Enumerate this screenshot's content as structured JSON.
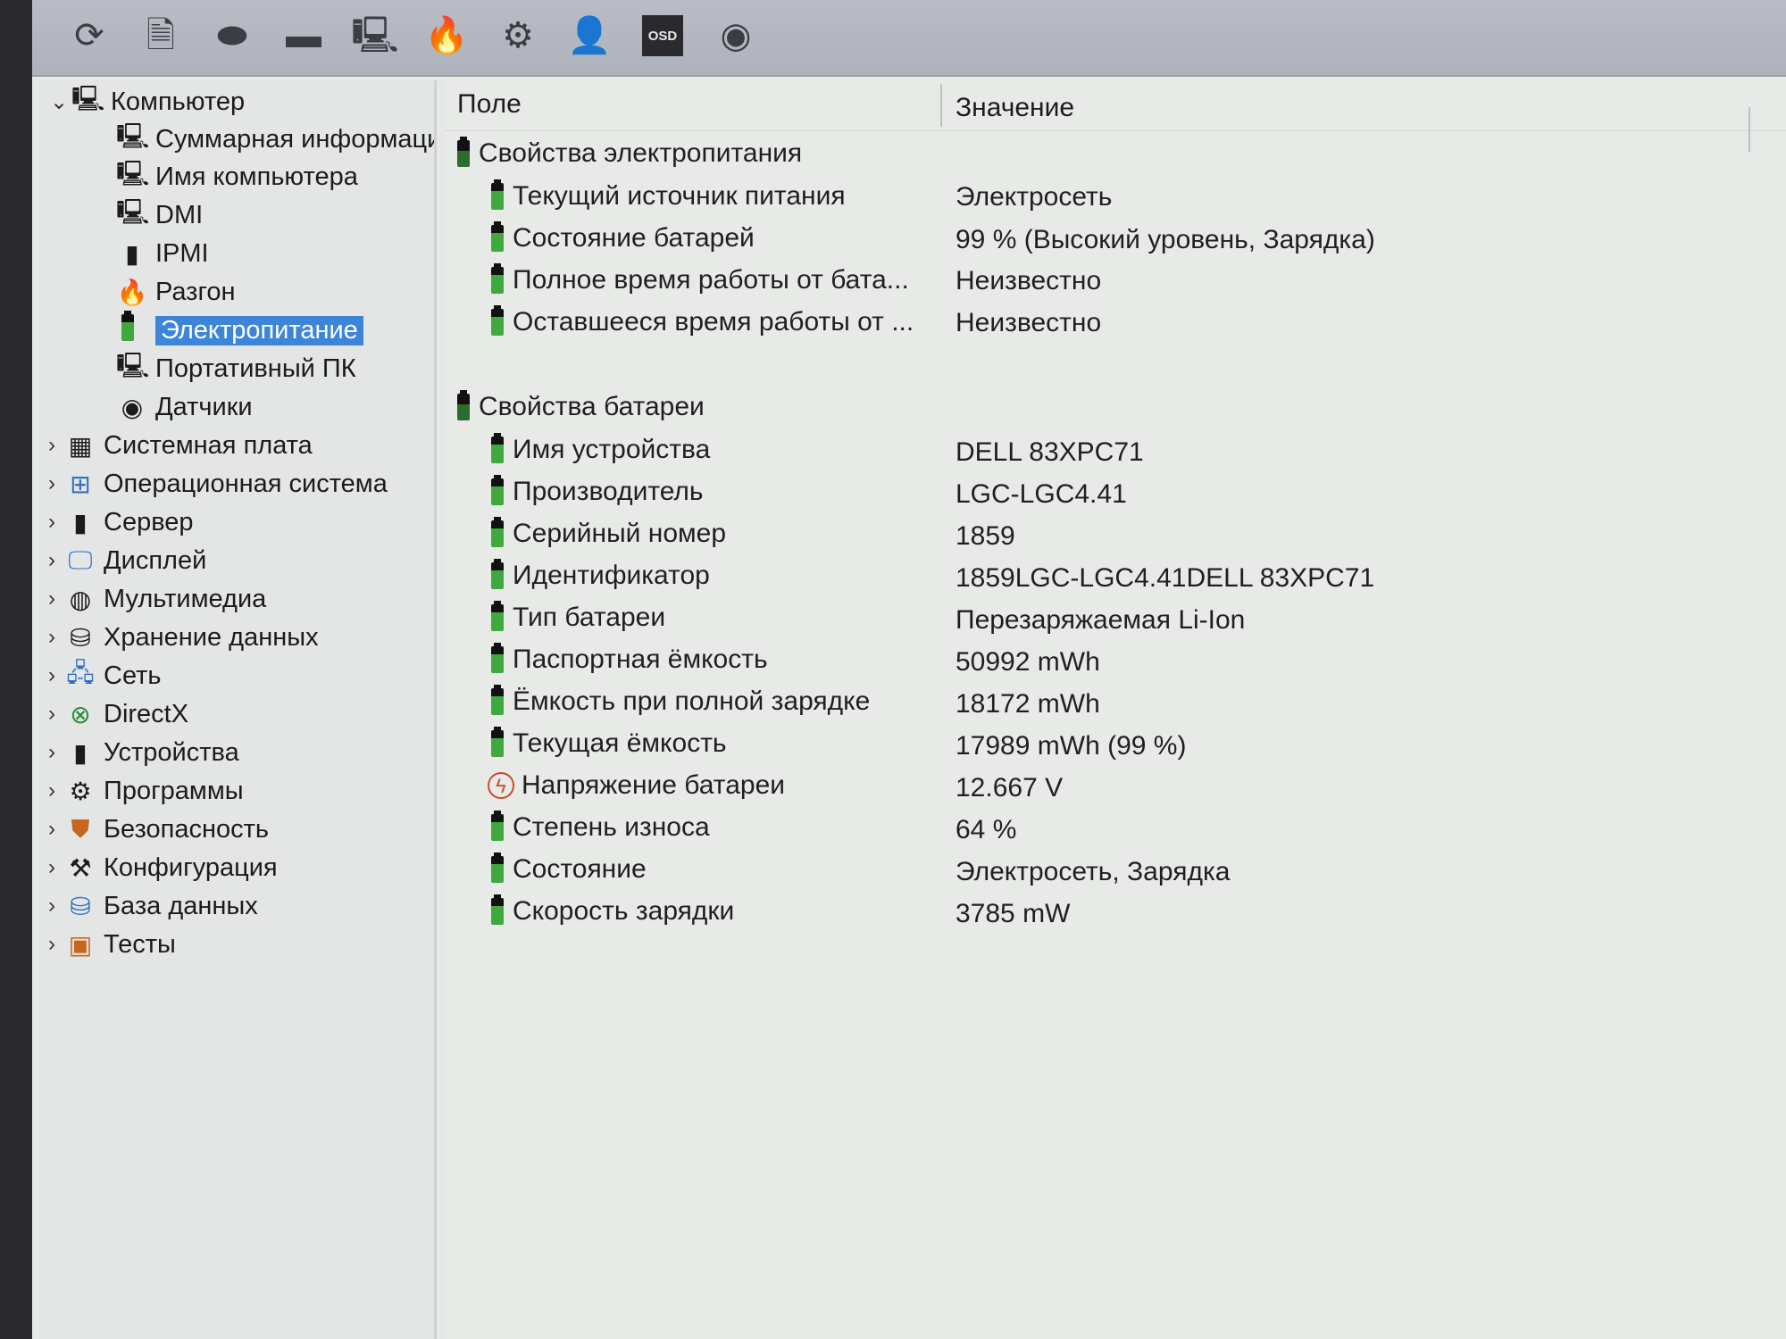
{
  "toolbar": {
    "buttons": [
      {
        "name": "refresh-icon",
        "glyph": "⟳"
      },
      {
        "name": "report-icon",
        "glyph": "🗎"
      },
      {
        "name": "drive-icon",
        "glyph": "⬬"
      },
      {
        "name": "monitor-icon",
        "glyph": "▬"
      },
      {
        "name": "computer-icon",
        "glyph": "🖳"
      },
      {
        "name": "flame-icon",
        "glyph": "🔥"
      },
      {
        "name": "tools-icon",
        "glyph": "⚙"
      },
      {
        "name": "user-icon",
        "glyph": "👤"
      },
      {
        "name": "osd-icon",
        "label": "OSD"
      },
      {
        "name": "sensor-icon",
        "glyph": "◉"
      }
    ]
  },
  "tree": {
    "root": "Компьютер",
    "children": [
      "Суммарная информация",
      "Имя компьютера",
      "DMI",
      "IPMI",
      "Разгон",
      "Электропитание",
      "Портативный ПК",
      "Датчики"
    ],
    "selected": "Электропитание",
    "categories": [
      "Системная плата",
      "Операционная система",
      "Сервер",
      "Дисплей",
      "Мультимедиа",
      "Хранение данных",
      "Сеть",
      "DirectX",
      "Устройства",
      "Программы",
      "Безопасность",
      "Конфигурация",
      "База данных",
      "Тесты"
    ]
  },
  "details": {
    "col_field": "Поле",
    "col_value": "Значение",
    "power_section": "Свойства электропитания",
    "power_rows": [
      {
        "field": "Текущий источник питания",
        "value": "Электросеть"
      },
      {
        "field": "Состояние батарей",
        "value": "99 % (Высокий уровень, Зарядка)"
      },
      {
        "field": "Полное время работы от бата...",
        "value": "Неизвестно"
      },
      {
        "field": "Оставшееся время работы от ...",
        "value": "Неизвестно"
      }
    ],
    "battery_section": "Свойства батареи",
    "battery_rows": [
      {
        "field": "Имя устройства",
        "value": "DELL 83XPC71"
      },
      {
        "field": "Производитель",
        "value": "LGC-LGC4.41"
      },
      {
        "field": "Серийный номер",
        "value": "1859"
      },
      {
        "field": "Идентификатор",
        "value": "1859LGC-LGC4.41DELL 83XPC71"
      },
      {
        "field": "Тип батареи",
        "value": "Перезаряжаемая Li-Ion"
      },
      {
        "field": "Паспортная ёмкость",
        "value": "50992 mWh"
      },
      {
        "field": "Ёмкость при полной зарядке",
        "value": "18172 mWh"
      },
      {
        "field": "Текущая ёмкость",
        "value": "17989 mWh  (99 %)"
      },
      {
        "field": "Напряжение батареи",
        "value": "12.667 V"
      },
      {
        "field": "Степень износа",
        "value": "64 %"
      },
      {
        "field": "Состояние",
        "value": "Электросеть, Зарядка"
      },
      {
        "field": "Скорость зарядки",
        "value": "3785 mW"
      }
    ]
  }
}
